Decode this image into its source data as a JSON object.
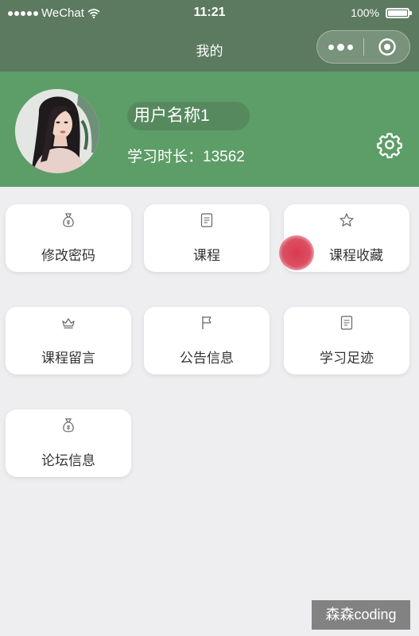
{
  "status_bar": {
    "carrier": "WeChat",
    "time": "11:21",
    "battery_text": "100%",
    "battery_level": 1.0
  },
  "nav": {
    "title": "我的"
  },
  "profile": {
    "username": "用户名称1",
    "study_time": "学习时长：13562"
  },
  "menu": {
    "items": [
      {
        "label": "修改密码",
        "icon": "money-bag-icon"
      },
      {
        "label": "课程",
        "icon": "document-icon"
      },
      {
        "label": "课程收藏",
        "icon": "star-icon"
      },
      {
        "label": "课程留言",
        "icon": "crown-icon"
      },
      {
        "label": "公告信息",
        "icon": "flag-icon"
      },
      {
        "label": "学习足迹",
        "icon": "document-icon"
      },
      {
        "label": "论坛信息",
        "icon": "money-bag-icon"
      }
    ]
  },
  "watermark": {
    "text": "森森coding"
  },
  "colors": {
    "nav_bg": "#5b7a5f",
    "profile_bg": "#5d9d67",
    "page_bg": "#eeedf0",
    "touch_indicator": "#d63048"
  }
}
